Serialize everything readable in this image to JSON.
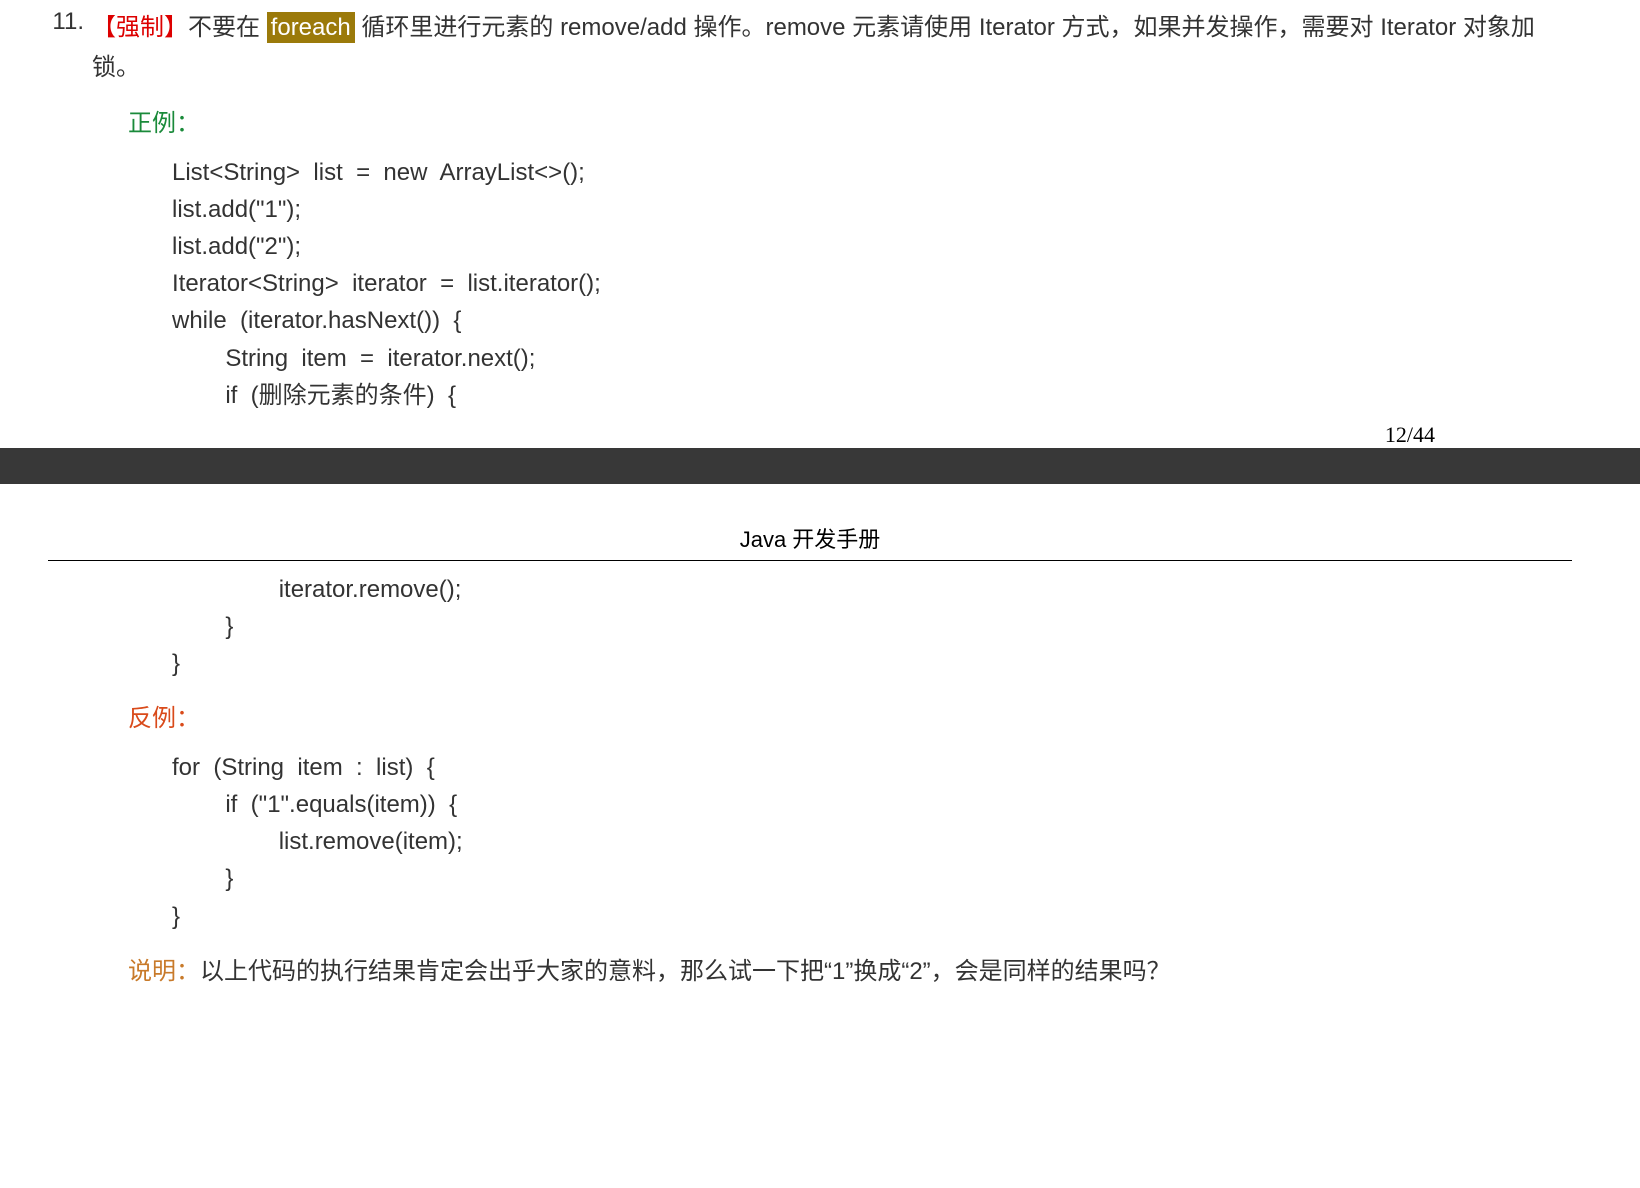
{
  "rule": {
    "number": "11.",
    "tag": "【强制】",
    "text_before_highlight": "不要在 ",
    "highlight": "foreach",
    "text_after_highlight": " 循环里进行元素的 remove/add 操作。remove 元素请使用 Iterator 方式，如果并发操作，需要对 Iterator 对象加锁。"
  },
  "labels": {
    "positive": "正例：",
    "negative": "反例：",
    "note": "说明："
  },
  "code": {
    "positive_part1": "List<String>  list  =  new  ArrayList<>();\nlist.add(\"1\");\nlist.add(\"2\");\nIterator<String>  iterator  =  list.iterator();\nwhile  (iterator.hasNext())  {\n        String  item  =  iterator.next();\n        if  (删除元素的条件)  {",
    "positive_part2": "                iterator.remove();\n        }\n}",
    "negative": "for  (String  item  :  list)  {\n        if  (\"1\".equals(item))  {\n                list.remove(item);\n        }\n}"
  },
  "note_text": "以上代码的执行结果肯定会出乎大家的意料，那么试一下把“1”换成“2”，会是同样的结果吗？",
  "page_number": "12/44",
  "doc_title": "Java 开发手册"
}
